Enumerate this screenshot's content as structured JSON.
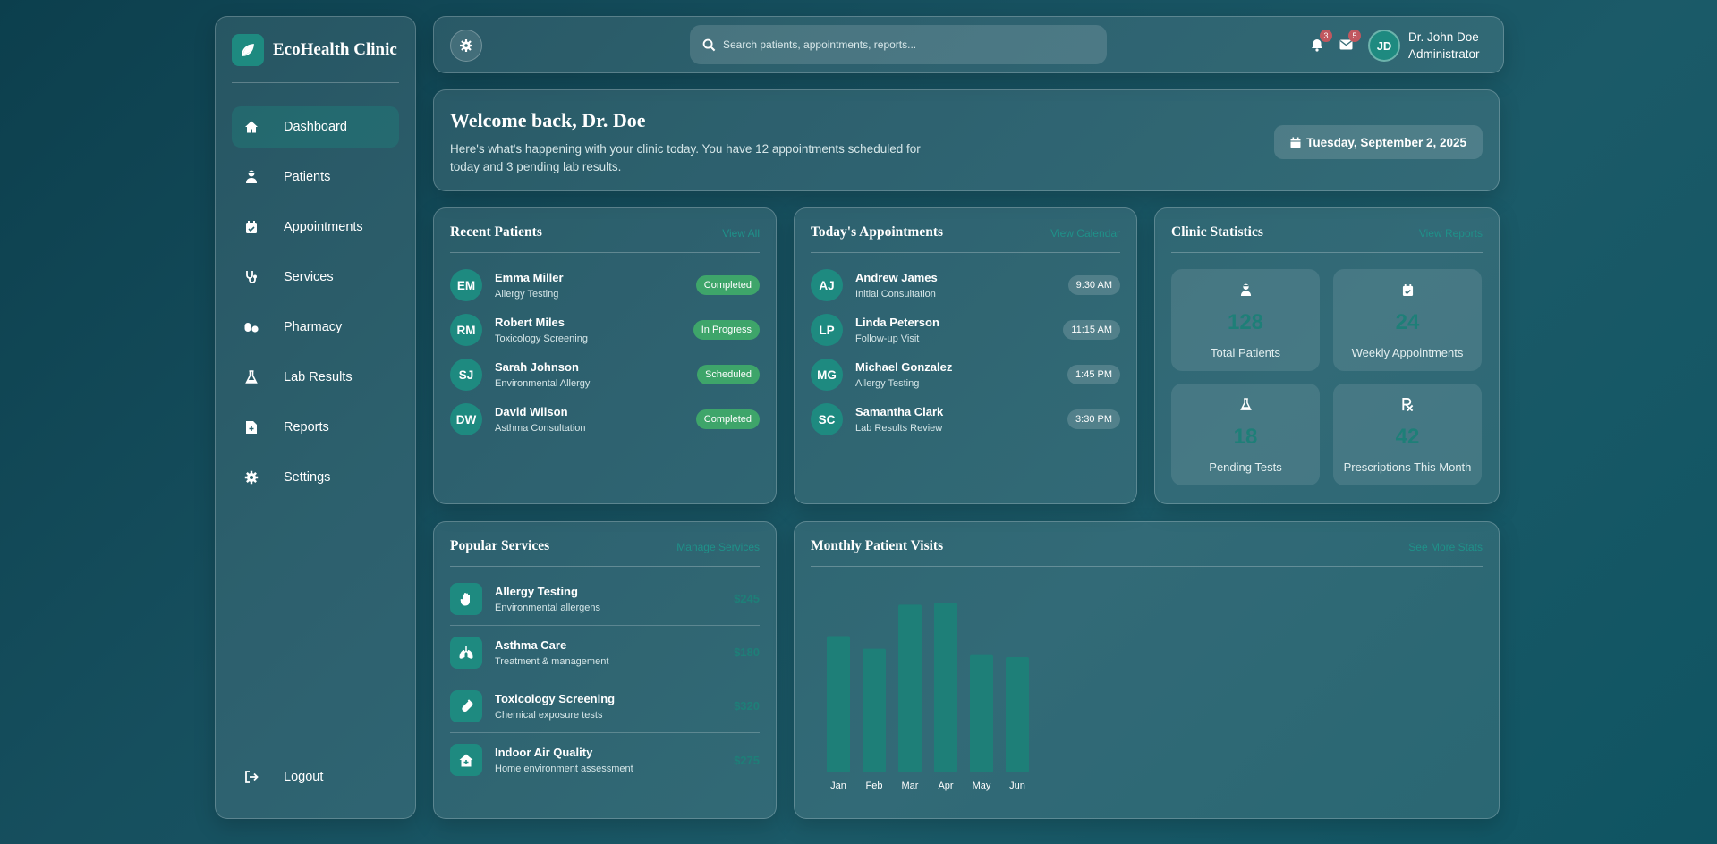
{
  "brand": {
    "name": "EcoHealth Clinic"
  },
  "nav": [
    {
      "label": "Dashboard",
      "icon": "home-icon",
      "active": true
    },
    {
      "label": "Patients",
      "icon": "user-injured-icon"
    },
    {
      "label": "Appointments",
      "icon": "calendar-check-icon"
    },
    {
      "label": "Services",
      "icon": "stethoscope-icon"
    },
    {
      "label": "Pharmacy",
      "icon": "pills-icon"
    },
    {
      "label": "Lab Results",
      "icon": "flask-icon"
    },
    {
      "label": "Reports",
      "icon": "file-medical-icon"
    },
    {
      "label": "Settings",
      "icon": "cog-icon"
    }
  ],
  "logout_label": "Logout",
  "topbar": {
    "search_placeholder": "Search patients, appointments, reports...",
    "notifications_count": "3",
    "messages_count": "5",
    "user_initials": "JD",
    "user_name": "Dr. John Doe",
    "user_role": "Administrator"
  },
  "welcome": {
    "title": "Welcome back, Dr. Doe",
    "message": "Here's what's happening with your clinic today. You have 12 appointments scheduled for today and 3 pending lab results.",
    "date": "Tuesday, September 2, 2025"
  },
  "recent_patients": {
    "title": "Recent Patients",
    "link": "View All",
    "items": [
      {
        "initials": "EM",
        "name": "Emma Miller",
        "detail": "Allergy Testing",
        "status": "Completed"
      },
      {
        "initials": "RM",
        "name": "Robert Miles",
        "detail": "Toxicology Screening",
        "status": "In Progress"
      },
      {
        "initials": "SJ",
        "name": "Sarah Johnson",
        "detail": "Environmental Allergy",
        "status": "Scheduled"
      },
      {
        "initials": "DW",
        "name": "David Wilson",
        "detail": "Asthma Consultation",
        "status": "Completed"
      }
    ]
  },
  "appointments": {
    "title": "Today's Appointments",
    "link": "View Calendar",
    "items": [
      {
        "initials": "AJ",
        "name": "Andrew James",
        "detail": "Initial Consultation",
        "time": "9:30 AM"
      },
      {
        "initials": "LP",
        "name": "Linda Peterson",
        "detail": "Follow-up Visit",
        "time": "11:15 AM"
      },
      {
        "initials": "MG",
        "name": "Michael Gonzalez",
        "detail": "Allergy Testing",
        "time": "1:45 PM"
      },
      {
        "initials": "SC",
        "name": "Samantha Clark",
        "detail": "Lab Results Review",
        "time": "3:30 PM"
      }
    ]
  },
  "stats": {
    "title": "Clinic Statistics",
    "link": "View Reports",
    "tiles": [
      {
        "value": "128",
        "label": "Total Patients",
        "icon": "user-injured-icon"
      },
      {
        "value": "24",
        "label": "Weekly Appointments",
        "icon": "calendar-check-icon"
      },
      {
        "value": "18",
        "label": "Pending Tests",
        "icon": "flask-icon"
      },
      {
        "value": "42",
        "label": "Prescriptions This Month",
        "icon": "prescription-icon"
      }
    ]
  },
  "services": {
    "title": "Popular Services",
    "link": "Manage Services",
    "items": [
      {
        "name": "Allergy Testing",
        "detail": "Environmental allergens",
        "price": "$245",
        "icon": "hand-icon"
      },
      {
        "name": "Asthma Care",
        "detail": "Treatment & management",
        "price": "$180",
        "icon": "lungs-icon"
      },
      {
        "name": "Toxicology Screening",
        "detail": "Chemical exposure tests",
        "price": "$320",
        "icon": "vial-icon"
      },
      {
        "name": "Indoor Air Quality",
        "detail": "Home environment assessment",
        "price": "$275",
        "icon": "house-icon"
      }
    ]
  },
  "visits": {
    "title": "Monthly Patient Visits",
    "link": "See More Stats"
  },
  "chart_data": {
    "type": "bar",
    "title": "Monthly Patient Visits",
    "categories": [
      "Jan",
      "Feb",
      "Mar",
      "Apr",
      "May",
      "Jun"
    ],
    "values": [
      65,
      59,
      80,
      81,
      56,
      55
    ],
    "bar_color": "#1e7f78"
  },
  "colors": {
    "accent": "#1e8a80",
    "status_green": "#3ea56a",
    "badge_red": "#c0575f"
  }
}
